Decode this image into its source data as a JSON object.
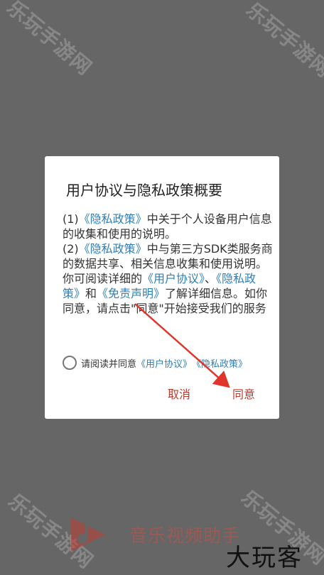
{
  "watermarks": [
    "乐玩手游网",
    "乐玩手游网",
    "乐玩手游网",
    "乐玩手游网"
  ],
  "dialog": {
    "title": "用户协议与隐私政策概要",
    "p1_prefix": "(1)",
    "p1_link": "《隐私政策》",
    "p1_suffix": "中关于个人设备用户信息的收集和使用的说明。",
    "p2_prefix": "(2)",
    "p2_link": "《隐私政策》",
    "p2_suffix": "中与第三方SDK类服务商的数据共享、相关信息收集和使用说明。",
    "p3_text1": "你可阅读详细的",
    "p3_link1": "《用户协议》",
    "p3_sep": "、",
    "p3_link2": "《隐私政策》",
    "p3_and": "和",
    "p3_link3": "《免责声明》",
    "p3_text2": "了解详细信息。如你同意，请点击\"同意\"开始接受我们的服务",
    "consent_text": "请阅读并同意",
    "consent_link1": "《用户协议》",
    "consent_link2": "《隐私政策》",
    "cancel_label": "取消",
    "agree_label": "同意"
  },
  "brand": {
    "name": "音乐视频助手",
    "corner": "大玩客"
  },
  "colors": {
    "overlay": "#666666",
    "link": "#2f7fb6",
    "button": "#c0392b",
    "arrow": "#e0352a"
  }
}
